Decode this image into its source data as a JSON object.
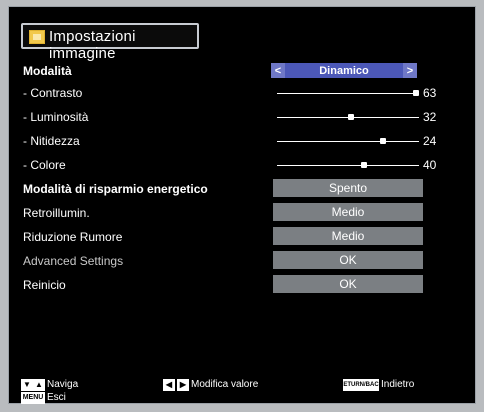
{
  "title": "Impostazioni immagine",
  "menu": {
    "mode_label": "Modalità",
    "mode_value": "Dinamico",
    "mode_prev": "<",
    "mode_next": ">",
    "rows": [
      {
        "label": "- Contrasto",
        "value": "63",
        "level": 1.0
      },
      {
        "label": "- Luminosità",
        "value": "32",
        "level": 0.52
      },
      {
        "label": "- Nitidezza",
        "value": "24",
        "level": 0.76
      },
      {
        "label": "- Colore",
        "value": "40",
        "level": 0.62
      }
    ],
    "energy_label": "Modalità di risparmio energetico",
    "energy_value": "Spento",
    "backlight_label": "Retroillumin.",
    "backlight_value": "Medio",
    "noise_label": "Riduzione Rumore",
    "noise_value": "Medio",
    "advanced_label": "Advanced Settings",
    "advanced_value": "OK",
    "reset_label": "Reinicio",
    "reset_value": "OK"
  },
  "legend": {
    "nav_text": "Naviga",
    "modify_text": "Modifica valore",
    "back_key": "RETURN/BACK",
    "back_text": "Indietro",
    "menu_key": "MENU",
    "exit_text": "Esci"
  },
  "icons": {
    "title_icon": "picture-settings-icon",
    "nav_icon": "arrow-up-down-icon",
    "modify_icon": "arrow-left-right-icon"
  }
}
